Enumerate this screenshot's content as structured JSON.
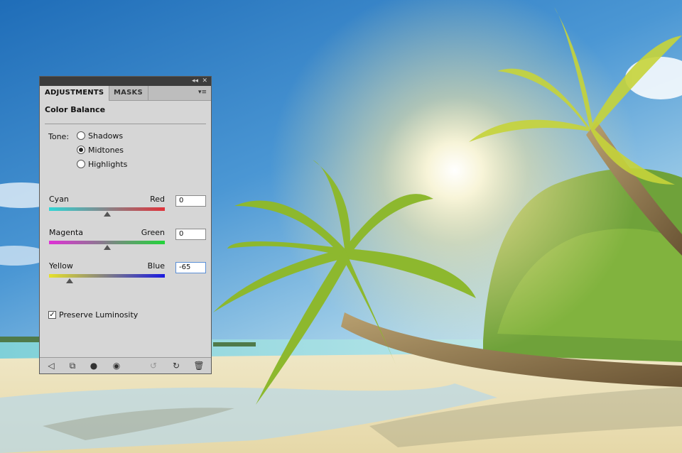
{
  "panel": {
    "tabs": [
      {
        "label": "ADJUSTMENTS",
        "active": true
      },
      {
        "label": "MASKS",
        "active": false
      }
    ],
    "title": "Color Balance",
    "tone": {
      "label": "Tone:",
      "options": [
        "Shadows",
        "Midtones",
        "Highlights"
      ],
      "selected": "Midtones"
    },
    "sliders": [
      {
        "left": "Cyan",
        "right": "Red",
        "value": "0",
        "fraction": 0.5
      },
      {
        "left": "Magenta",
        "right": "Green",
        "value": "0",
        "fraction": 0.5
      },
      {
        "left": "Yellow",
        "right": "Blue",
        "value": "-65",
        "fraction": 0.175
      }
    ],
    "preserve_luminosity": {
      "label": "Preserve Luminosity",
      "checked": true
    },
    "bottom_icons": [
      "back-arrow-icon",
      "clip-to-layer-icon",
      "layer-mask-icon",
      "visibility-eye-icon",
      "previous-state-icon",
      "reset-icon",
      "trash-icon"
    ]
  },
  "colors": {
    "cyan_red": [
      "#2fd6d6",
      "#e0323a"
    ],
    "magenta_green": [
      "#e02fd6",
      "#22d43a"
    ],
    "yellow_blue": [
      "#e6e12a",
      "#1a1ae0"
    ]
  }
}
